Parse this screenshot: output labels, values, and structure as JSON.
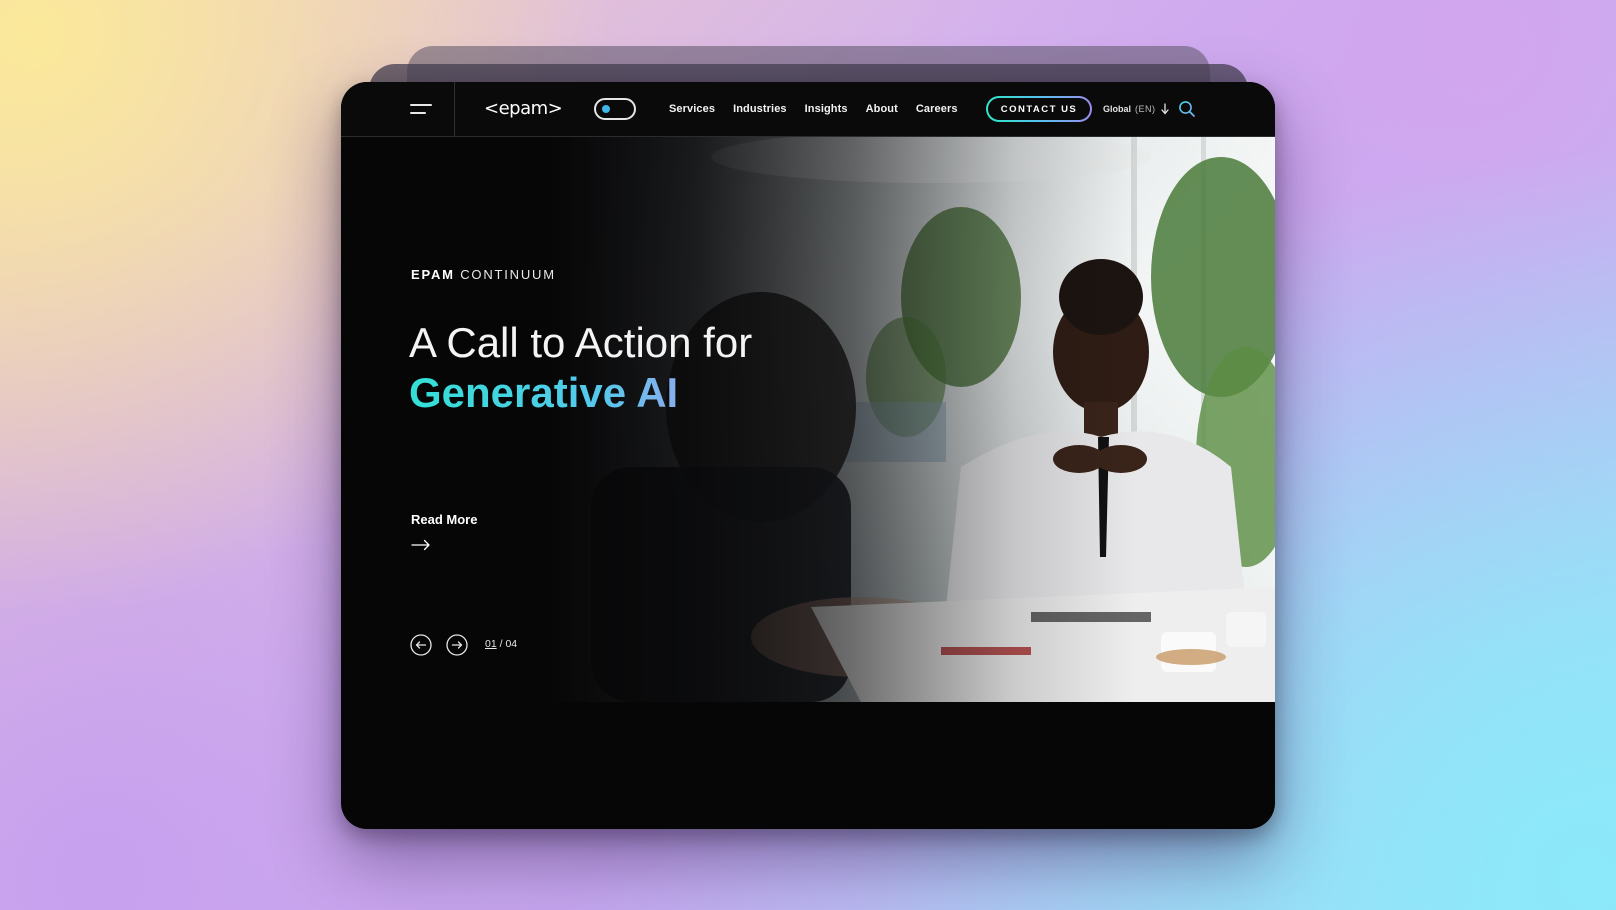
{
  "nav": {
    "logo": "<epam>",
    "links": [
      "Services",
      "Industries",
      "Insights",
      "About",
      "Careers"
    ],
    "contact_label": "CONTACT US",
    "lang_global": "Global",
    "lang_code": "(EN)"
  },
  "hero": {
    "eyebrow_brand": "EPAM",
    "eyebrow_sub": "CONTINUUM",
    "headline_line1": "A Call to Action for",
    "headline_line2": "Generative AI",
    "read_more": "Read More",
    "slide_current": "01",
    "slide_separator": "/",
    "slide_total": "04"
  },
  "colors": {
    "accent_teal": "#33e0d6",
    "accent_blue": "#55c8ec",
    "accent_purple": "#b797ef",
    "toggle_dot": "#3fb7e6"
  },
  "icons": [
    "hamburger-menu-icon",
    "theme-toggle",
    "chevron-down-icon",
    "search-icon",
    "arrow-right-icon",
    "arrow-left-circle-icon",
    "arrow-right-circle-icon"
  ]
}
